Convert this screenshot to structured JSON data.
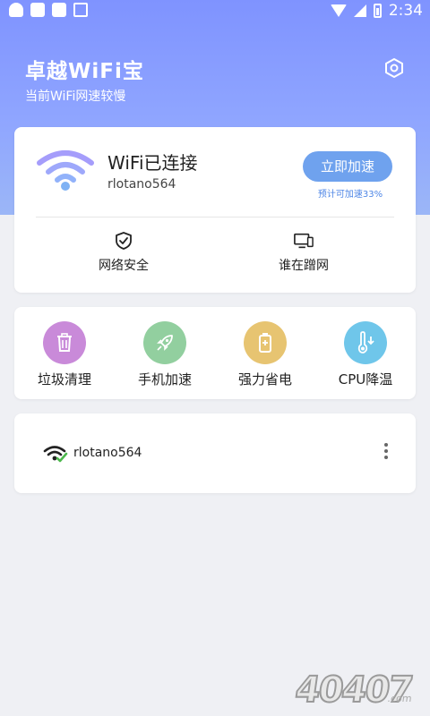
{
  "statusbar": {
    "time": "2:34"
  },
  "header": {
    "title": "卓越WiFi宝",
    "subtitle": "当前WiFi网速较慢"
  },
  "connection": {
    "status": "WiFi已连接",
    "ssid": "rlotano564",
    "boost_label": "立即加速",
    "boost_hint": "预计可加速33%"
  },
  "quick_actions": [
    {
      "label": "网络安全",
      "icon": "shield-icon"
    },
    {
      "label": "谁在蹭网",
      "icon": "devices-icon"
    }
  ],
  "tools": [
    {
      "label": "垃圾清理",
      "icon": "trash-icon",
      "color": "#c98ad9"
    },
    {
      "label": "手机加速",
      "icon": "rocket-icon",
      "color": "#92cf9f"
    },
    {
      "label": "强力省电",
      "icon": "battery-icon",
      "color": "#e7c471"
    },
    {
      "label": "CPU降温",
      "icon": "thermometer-icon",
      "color": "#6fc6ea"
    }
  ],
  "network_list": [
    {
      "ssid": "rlotano564"
    }
  ],
  "watermark": {
    "text": "40407.com"
  },
  "colors": {
    "accent": "#6fa2ee",
    "header_top": "#7f93ff",
    "background": "#eff0f4"
  }
}
